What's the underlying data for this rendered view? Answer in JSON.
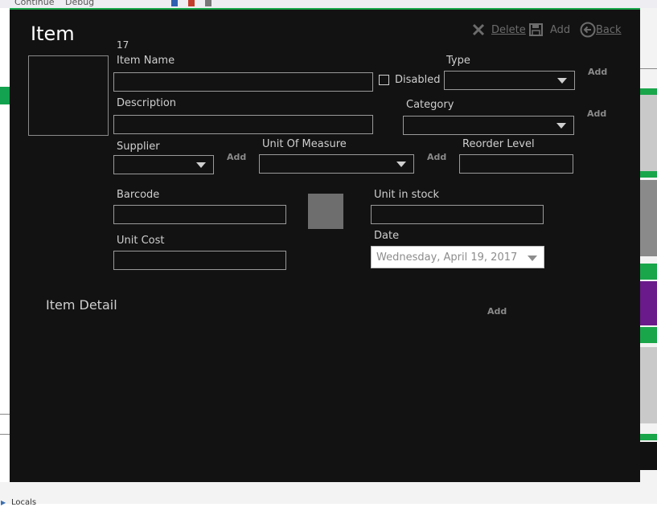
{
  "window": {
    "title": "Item",
    "item_id": "17"
  },
  "commands": {
    "delete_label": "Delete",
    "add_label": "Add",
    "back_label": "Back"
  },
  "form": {
    "item_name": {
      "label": "Item Name",
      "value": ""
    },
    "disabled": {
      "label": "Disabled",
      "checked": false
    },
    "type": {
      "label": "Type",
      "selected": "",
      "add_label": "Add"
    },
    "description": {
      "label": "Description",
      "value": ""
    },
    "category": {
      "label": "Category",
      "selected": "",
      "add_label": "Add"
    },
    "supplier": {
      "label": "Supplier",
      "selected": "",
      "add_label": "Add"
    },
    "unit_of_measure": {
      "label": "Unit Of Measure",
      "selected": "",
      "add_label": "Add"
    },
    "reorder_level": {
      "label": "Reorder Level",
      "value": ""
    },
    "barcode": {
      "label": "Barcode",
      "value": ""
    },
    "unit_in_stock": {
      "label": "Unit in stock",
      "value": ""
    },
    "unit_cost": {
      "label": "Unit Cost",
      "value": ""
    },
    "date": {
      "label": "Date",
      "value": "Wednesday, April 19, 2017"
    }
  },
  "item_detail": {
    "title": "Item Detail",
    "add_label": "Add"
  },
  "background": {
    "toolbar_items": [
      "Continue",
      "Debug"
    ],
    "bottom_panel_label": "Locals"
  },
  "colors": {
    "dialog_bg": "#121212",
    "accent_green": "#19a64a",
    "field_border": "#9a9a9a",
    "command_text": "#6c6c6c"
  },
  "icons": {
    "delete": "close-x-icon",
    "add": "save-floppy-icon",
    "back": "back-arrow-circle-icon",
    "dropdown": "chevron-down-icon"
  }
}
